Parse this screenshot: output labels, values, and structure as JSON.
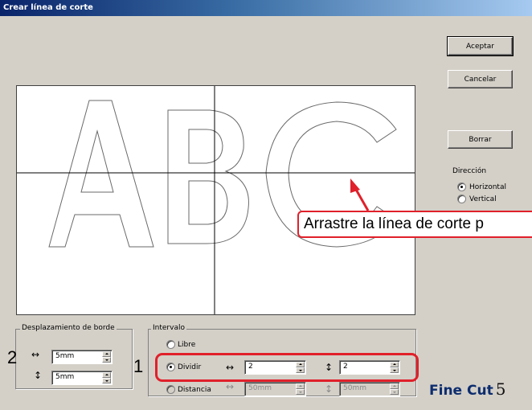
{
  "window": {
    "title": "Crear línea de corte"
  },
  "buttons": {
    "ok": "Aceptar",
    "cancel": "Cancelar",
    "clear": "Borrar"
  },
  "direction": {
    "label": "Dirección",
    "horizontal": "Horizontal",
    "vertical": "Vertical",
    "selected": "horizontal"
  },
  "preview": {
    "letters": "ABC"
  },
  "callout": {
    "text": "Arrastre la línea de corte p"
  },
  "edge_offset": {
    "legend": "Desplazamiento de borde",
    "horizontal_value": "5mm",
    "vertical_value": "5mm",
    "horizontal_symbol": "↔",
    "vertical_symbol": "↕"
  },
  "interval": {
    "legend": "Intervalo",
    "free": "Libre",
    "divide": "Dividir",
    "distance": "Distancia",
    "selected": "divide",
    "divide_h": "2",
    "divide_v": "2",
    "distance_h": "50mm",
    "distance_v": "50mm",
    "horizontal_symbol": "↔",
    "vertical_symbol": "↕"
  },
  "annotations": {
    "marker_1": "1",
    "marker_2": "2",
    "highlight_color": "#e0202a"
  },
  "logo": {
    "text": "Fine Cut",
    "version": "5"
  }
}
